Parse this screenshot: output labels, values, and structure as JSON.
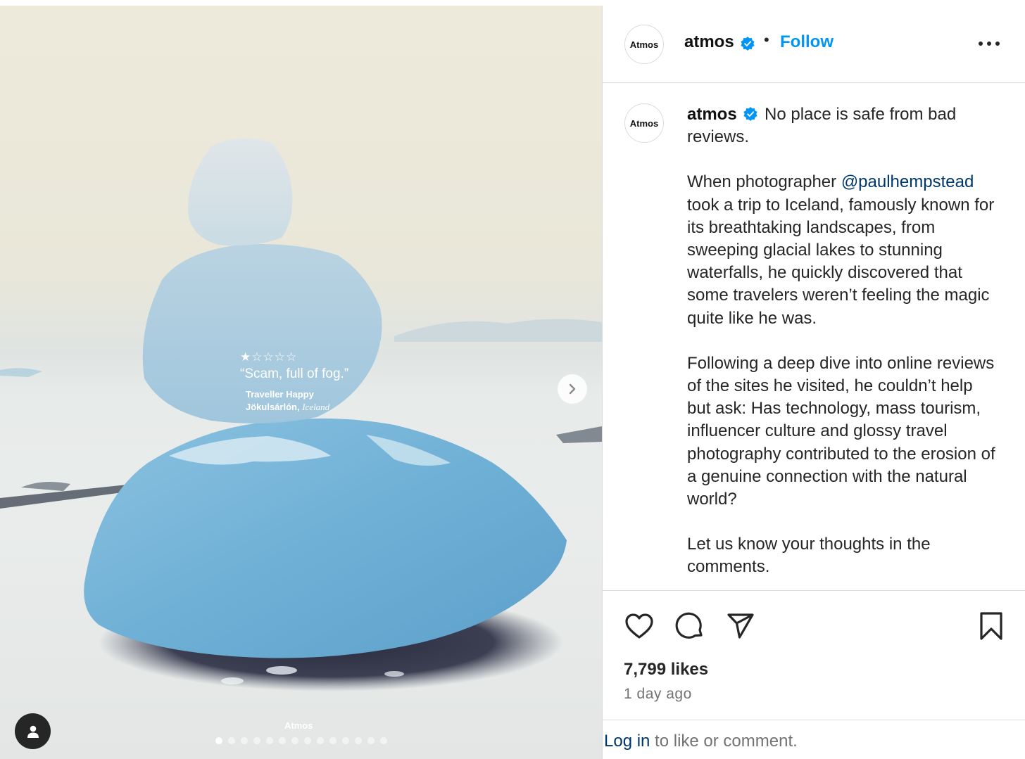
{
  "post": {
    "account": "atmos",
    "avatar_text": "Atmos",
    "follow_label": "Follow",
    "separator": "•",
    "verified_icon": "verified-badge-icon",
    "more_icon": "more-options-icon"
  },
  "photo": {
    "review": {
      "stars": "★☆☆☆☆",
      "quote": "“Scam, full of fog.”",
      "reviewer": "Traveller Happy",
      "place": "Jökulsárlón,",
      "country": "Iceland"
    },
    "watermark": "Atmos",
    "slide_count": 14,
    "active_slide": 1,
    "next_icon": "chevron-right-icon",
    "tag_icon": "user-tag-icon"
  },
  "caption": {
    "account": "atmos",
    "first_line": "No place is safe from bad reviews.",
    "p2_before": "When photographer ",
    "mention": "@paulhempstead",
    "p2_after": " took a trip to Iceland, famously known for its breathtaking landscapes, from sweeping glacial lakes to stunning waterfalls, he quickly discovered that some travelers weren’t feeling the magic quite like he was.",
    "p3": "Following a deep dive into online reviews of the sites he visited, he couldn’t help but ask: Has technology, mass tourism, influencer culture and glossy travel photography contributed to the erosion of a genuine connection with the natural world?",
    "p4": "Let us know your thoughts in the comments."
  },
  "actions": {
    "icons": [
      "heart-icon",
      "comment-icon",
      "share-icon",
      "bookmark-icon"
    ],
    "likes": "7,799 likes",
    "time_ago": "1 day ago"
  },
  "login": {
    "link": "Log in",
    "rest": " to like or comment."
  },
  "colors": {
    "follow": "#0095f6",
    "verified": "#0095f6",
    "mention": "#00376b",
    "muted": "#737373",
    "ice": "#6fb4d6"
  }
}
